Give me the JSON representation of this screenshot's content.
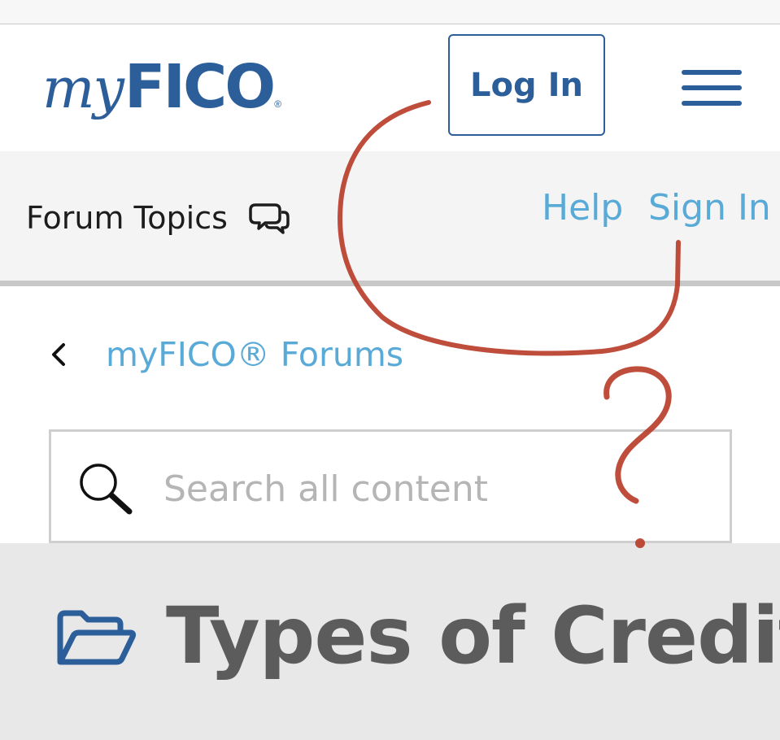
{
  "header": {
    "logo_my": "my",
    "logo_fico": "FICO",
    "logo_reg": "®",
    "login_label": "Log In"
  },
  "subnav": {
    "forum_topics_label": "Forum Topics",
    "help_label": "Help",
    "sign_in_label": "Sign In"
  },
  "breadcrumb": {
    "label": "myFICO® Forums"
  },
  "search": {
    "placeholder": "Search all content",
    "value": ""
  },
  "category": {
    "title": "Types of Credit"
  },
  "annotation": {
    "mark": "?"
  },
  "colors": {
    "brand_blue": "#2c5f9a",
    "link_blue": "#5aaad8",
    "annotation_red": "#b83a26"
  },
  "icons": {
    "menu": "hamburger-menu-icon",
    "forum_topics": "chat-bubbles-icon",
    "back": "chevron-left-icon",
    "search": "search-icon",
    "category": "folder-open-icon"
  }
}
